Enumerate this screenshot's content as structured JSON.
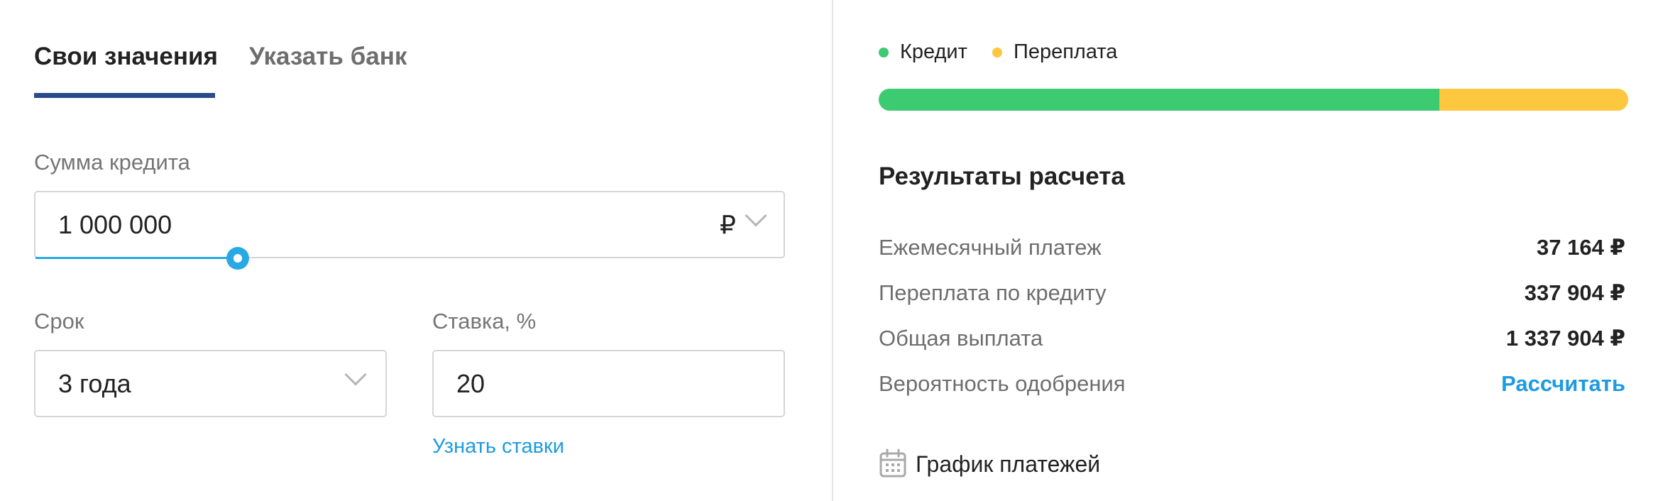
{
  "tabs": [
    {
      "label": "Свои значения",
      "active": true
    },
    {
      "label": "Указать банк",
      "active": false
    }
  ],
  "loan_amount": {
    "label": "Сумма кредита",
    "value": "1 000 000",
    "currency": "₽",
    "slider_fraction": 0.27
  },
  "term": {
    "label": "Срок",
    "value": "3 года"
  },
  "rate": {
    "label": "Ставка, %",
    "value": "20",
    "link": "Узнать ставки"
  },
  "legend": [
    {
      "label": "Кредит",
      "color": "#3dcb72"
    },
    {
      "label": "Переплата",
      "color": "#fdc740"
    }
  ],
  "breakdown": {
    "credit_fraction": 0.748,
    "overpayment_fraction": 0.252
  },
  "results": {
    "title": "Результаты расчета",
    "rows": [
      {
        "label": "Ежемесячный платеж",
        "value": "37 164 ₽"
      },
      {
        "label": "Переплата по кредиту",
        "value": "337 904 ₽"
      },
      {
        "label": "Общая выплата",
        "value": "1 337 904 ₽"
      },
      {
        "label": "Вероятность одобрения",
        "value": "Рассчитать"
      }
    ]
  },
  "schedule": {
    "label": "График платежей",
    "icon": "calendar-icon"
  },
  "colors": {
    "accent": "#2b4a8b",
    "link": "#1e9be0",
    "slider": "#28a9e6"
  }
}
